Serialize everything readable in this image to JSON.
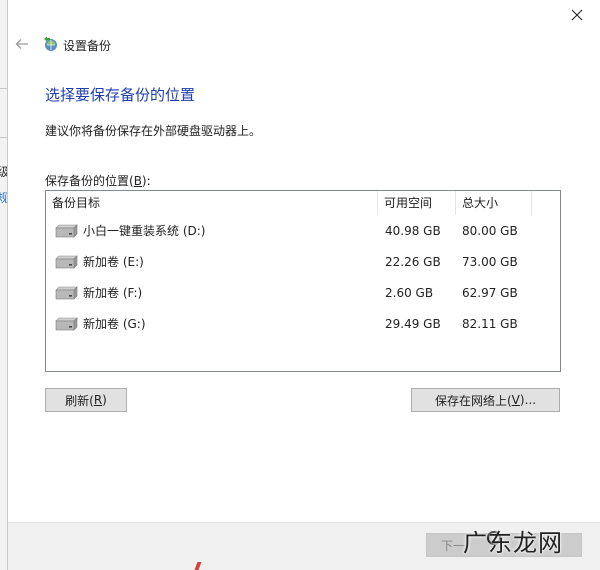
{
  "window": {
    "title": "设置备份",
    "heading": "选择要保存备份的位置",
    "subtitle": "建议你将备份保存在外部硬盘驱动器上。",
    "list_label_pre": "保存备份的位置(",
    "list_label_key": "B",
    "list_label_post": "):"
  },
  "behind_window": {
    "glyph1": "级",
    "glyph2": "规"
  },
  "columns": {
    "target": "备份目标",
    "free": "可用空间",
    "total": "总大小"
  },
  "drives": [
    {
      "name": "小白一键重装系统 (D:)",
      "free": "40.98 GB",
      "total": "80.00 GB",
      "icon": "hard-drive-icon"
    },
    {
      "name": "新加卷 (E:)",
      "free": "22.26 GB",
      "total": "73.00 GB",
      "icon": "hard-drive-icon"
    },
    {
      "name": "新加卷 (F:)",
      "free": "2.60 GB",
      "total": "62.97 GB",
      "icon": "hard-drive-icon"
    },
    {
      "name": "新加卷 (G:)",
      "free": "29.49 GB",
      "total": "82.11 GB",
      "icon": "hard-drive-icon"
    }
  ],
  "buttons": {
    "refresh_pre": "刷新(",
    "refresh_key": "R",
    "refresh_post": ")",
    "network_pre": "保存在网络上(",
    "network_key": "V",
    "network_post": ")...",
    "next": "下一"
  },
  "watermark": "广东龙网",
  "colors": {
    "heading": "#1f3fae",
    "button_bg": "#e1e1e1",
    "footer_bg": "#f0f0f0",
    "next_disabled_bg": "#cccccc"
  }
}
